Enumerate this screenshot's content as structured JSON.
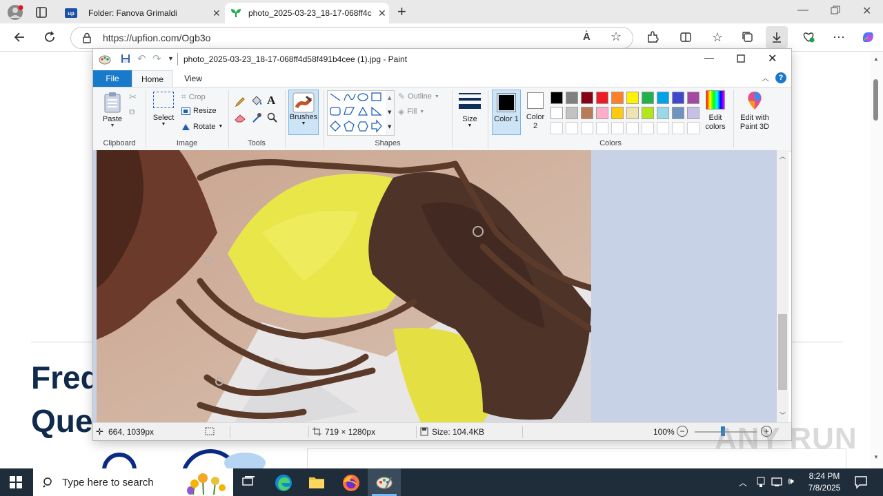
{
  "browser": {
    "tabs": [
      {
        "title": "Folder: Fanova Grimaldi",
        "icon": "upfion-icon"
      },
      {
        "title": "photo_2025-03-23_18-17-068ff4c",
        "icon": "leaf-icon"
      }
    ],
    "url": "https://upfion.com/Ogb3o"
  },
  "webpage": {
    "heading_line1": "Freq",
    "heading_line2": "Ques"
  },
  "paint": {
    "title": "photo_2025-03-23_18-17-068ff4d58f491b4cee (1).jpg - Paint",
    "tabs": {
      "file": "File",
      "home": "Home",
      "view": "View"
    },
    "clipboard": {
      "paste": "Paste",
      "group": "Clipboard"
    },
    "image": {
      "select": "Select",
      "crop": "Crop",
      "resize": "Resize",
      "rotate": "Rotate",
      "group": "Image"
    },
    "tools": {
      "group": "Tools"
    },
    "brushes": {
      "label": "Brushes"
    },
    "shapes": {
      "outline": "Outline",
      "fill": "Fill",
      "group": "Shapes"
    },
    "size": {
      "label": "Size"
    },
    "colors": {
      "color1": "Color 1",
      "color2": "Color 2",
      "edit_colors": "Edit colors",
      "edit_3d": "Edit with Paint 3D",
      "group": "Colors",
      "palette_row1": [
        "#000000",
        "#7f7f7f",
        "#880015",
        "#ed1c24",
        "#ff7f27",
        "#fff200",
        "#22b14c",
        "#00a2e8",
        "#3f48cc",
        "#a349a4"
      ],
      "palette_row2": [
        "#ffffff",
        "#c3c3c3",
        "#b97a57",
        "#ffaec9",
        "#ffc90e",
        "#efe4b0",
        "#b5e61d",
        "#99d9ea",
        "#7092be",
        "#c8bfe7"
      ],
      "palette_row3": [
        "#ffffff",
        "#ffffff",
        "#ffffff",
        "#ffffff",
        "#ffffff",
        "#ffffff",
        "#ffffff",
        "#ffffff",
        "#ffffff",
        "#ffffff"
      ]
    },
    "status": {
      "cursor": "664, 1039px",
      "dimensions": "719 × 1280px",
      "size": "Size: 104.4KB",
      "zoom": "100%"
    }
  },
  "watermark": "ANY RUN",
  "taskbar": {
    "search_placeholder": "Type here to search",
    "time": "8:24 PM",
    "date": "7/8/2025"
  }
}
